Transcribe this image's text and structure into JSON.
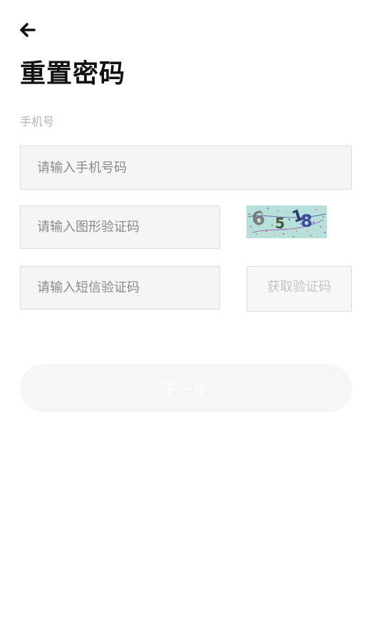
{
  "header": {
    "back_icon": "arrow-left-icon",
    "title": "重置密码"
  },
  "form": {
    "phone_label": "手机号",
    "phone_placeholder": "请输入手机号码",
    "captcha_placeholder": "请输入图形验证码",
    "captcha_image_chars": "6518",
    "sms_placeholder": "请输入短信验证码",
    "get_code_label": "获取验证码",
    "next_label": "下一步"
  },
  "colors": {
    "background": "#ffffff",
    "title": "#111111",
    "label": "#b3b3b3",
    "placeholder": "#8a8a8a",
    "field_bg": "#f5f5f5",
    "field_border": "#dcdcdc",
    "disabled_text": "#c4c4c4",
    "button_bg_disabled": "#f6f6f6",
    "captcha_bg": "#b7e0dc"
  }
}
